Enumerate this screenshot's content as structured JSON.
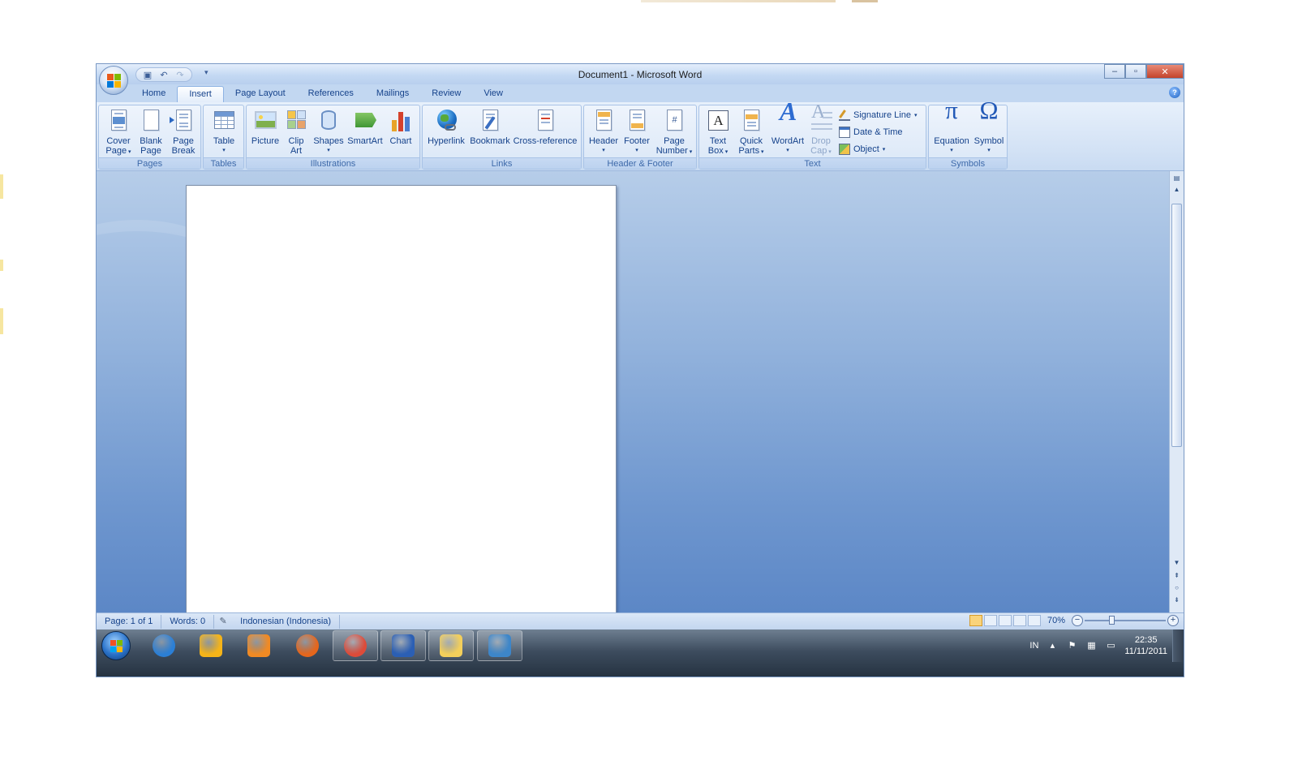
{
  "window": {
    "title": "Document1 - Microsoft Word",
    "controls": {
      "minimize": "‒",
      "maximize": "▫",
      "close": "✕"
    }
  },
  "quick_access": {
    "save_icon": "save-icon",
    "undo_icon": "undo-icon",
    "redo_icon": "redo-icon"
  },
  "tabs": [
    {
      "label": "Home",
      "active": false
    },
    {
      "label": "Insert",
      "active": true
    },
    {
      "label": "Page Layout",
      "active": false
    },
    {
      "label": "References",
      "active": false
    },
    {
      "label": "Mailings",
      "active": false
    },
    {
      "label": "Review",
      "active": false
    },
    {
      "label": "View",
      "active": false
    }
  ],
  "ribbon": {
    "pages": {
      "label": "Pages",
      "cover_page": [
        "Cover",
        "Page"
      ],
      "blank_page": [
        "Blank",
        "Page"
      ],
      "page_break": [
        "Page",
        "Break"
      ]
    },
    "tables": {
      "label": "Tables",
      "table": "Table"
    },
    "illustrations": {
      "label": "Illustrations",
      "picture": "Picture",
      "clip_art": [
        "Clip",
        "Art"
      ],
      "shapes": "Shapes",
      "smartart": "SmartArt",
      "chart": "Chart"
    },
    "links": {
      "label": "Links",
      "hyperlink": "Hyperlink",
      "bookmark": "Bookmark",
      "cross_reference": "Cross-reference"
    },
    "header_footer": {
      "label": "Header & Footer",
      "header": "Header",
      "footer": "Footer",
      "page_number": [
        "Page",
        "Number"
      ]
    },
    "text": {
      "label": "Text",
      "text_box": [
        "Text",
        "Box"
      ],
      "quick_parts": [
        "Quick",
        "Parts"
      ],
      "wordart": "WordArt",
      "drop_cap": [
        "Drop",
        "Cap"
      ],
      "signature_line": "Signature Line",
      "date_time": "Date & Time",
      "object": "Object"
    },
    "symbols": {
      "label": "Symbols",
      "equation": "Equation",
      "symbol": "Symbol",
      "equation_glyph": "π",
      "symbol_glyph": "Ω"
    }
  },
  "status_bar": {
    "page": "Page: 1 of 1",
    "words": "Words: 0",
    "language": "Indonesian (Indonesia)",
    "zoom": "70%",
    "zoom_percent": 70
  },
  "taskbar": {
    "apps": [
      {
        "name": "internet-explorer",
        "color": "#2b7fd6"
      },
      {
        "name": "winamp",
        "color": "#f5b419"
      },
      {
        "name": "media-player",
        "color": "#f08a24"
      },
      {
        "name": "firefox",
        "color": "#e5661c"
      },
      {
        "name": "chrome",
        "color": "#dd4b39"
      },
      {
        "name": "word",
        "color": "#2b5fb4"
      },
      {
        "name": "explorer",
        "color": "#f3cf5b"
      },
      {
        "name": "photo-viewer",
        "color": "#3d86c9"
      }
    ],
    "language": "IN",
    "time": "22:35",
    "date": "11/11/2011"
  },
  "colors": {
    "ribbon_text": "#15428b",
    "doc_background": "#6f97cf",
    "taskbar": "#3d4c5e"
  }
}
